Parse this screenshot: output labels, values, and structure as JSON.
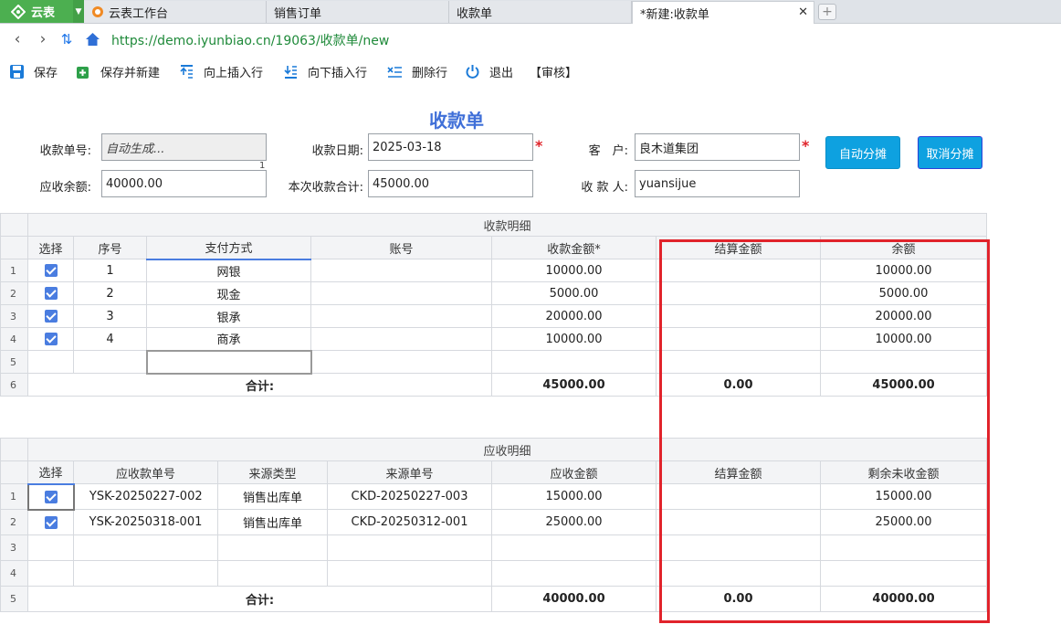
{
  "tabs": {
    "app_name": "云表",
    "items": [
      "云表工作台",
      "销售订单",
      "收款单",
      "*新建:收款单"
    ]
  },
  "address": {
    "url": "https://demo.iyunbiao.cn/19063/收款单/new"
  },
  "toolbar": {
    "save": "保存",
    "save_new": "保存并新建",
    "insert_up": "向上插入行",
    "insert_down": "向下插入行",
    "delete_row": "删除行",
    "exit": "退出",
    "review": "【审核】"
  },
  "form": {
    "title": "收款单",
    "no_label": "收款单号:",
    "no_value": "自动生成...",
    "no_marker": "1",
    "date_label": "收款日期:",
    "date_value": "2025-03-18",
    "customer_label": "客　户:",
    "customer_value": "良木道集团",
    "balance_label": "应收余额:",
    "balance_value": "40000.00",
    "total_label": "本次收款合计:",
    "total_value": "45000.00",
    "payee_label": "收 款 人:",
    "payee_value": "yuansijue",
    "auto_alloc": "自动分摊",
    "cancel_alloc": "取消分摊",
    "required_mark": "*"
  },
  "receipt_detail": {
    "section_title": "收款明细",
    "headers": [
      "选择",
      "序号",
      "支付方式",
      "账号",
      "收款金额*",
      "结算金额",
      "余额"
    ],
    "rows": [
      {
        "rn": "1",
        "seq": "1",
        "method": "网银",
        "account": "",
        "amount": "10000.00",
        "settled": "",
        "balance": "10000.00"
      },
      {
        "rn": "2",
        "seq": "2",
        "method": "现金",
        "account": "",
        "amount": "5000.00",
        "settled": "",
        "balance": "5000.00"
      },
      {
        "rn": "3",
        "seq": "3",
        "method": "银承",
        "account": "",
        "amount": "20000.00",
        "settled": "",
        "balance": "20000.00"
      },
      {
        "rn": "4",
        "seq": "4",
        "method": "商承",
        "account": "",
        "amount": "10000.00",
        "settled": "",
        "balance": "10000.00"
      }
    ],
    "empty_rn": "5",
    "total_rn": "6",
    "total_label": "合计:",
    "total_amount": "45000.00",
    "total_settled": "0.00",
    "total_balance": "45000.00"
  },
  "receivable_detail": {
    "section_title": "应收明细",
    "headers": [
      "选择",
      "应收款单号",
      "来源类型",
      "来源单号",
      "应收金额",
      "结算金额",
      "剩余未收金额"
    ],
    "rows": [
      {
        "rn": "1",
        "no": "YSK-20250227-002",
        "type": "销售出库单",
        "src": "CKD-20250227-003",
        "amount": "15000.00",
        "settled": "",
        "remain": "15000.00"
      },
      {
        "rn": "2",
        "no": "YSK-20250318-001",
        "type": "销售出库单",
        "src": "CKD-20250312-001",
        "amount": "25000.00",
        "settled": "",
        "remain": "25000.00"
      }
    ],
    "empty_rns": [
      "3",
      "4"
    ],
    "total_rn": "5",
    "total_label": "合计:",
    "total_amount": "40000.00",
    "total_settled": "0.00",
    "total_remain": "40000.00"
  },
  "colors": {
    "accent": "#3f6fd8",
    "highlight": "#e1232b",
    "button": "#0ea1e0",
    "app_green": "#4caf50"
  }
}
